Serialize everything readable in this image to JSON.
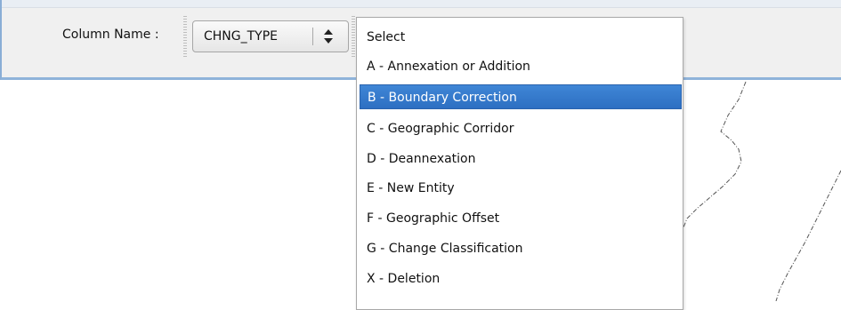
{
  "toolbar": {
    "column_label": "Column Name :",
    "column_select": {
      "value": "CHNG_TYPE"
    }
  },
  "dropdown": {
    "options": [
      "Select",
      "A - Annexation or Addition",
      "B - Boundary Correction",
      "C - Geographic Corridor",
      "D - Deannexation",
      "E - New Entity",
      "F - Geographic Offset",
      "G - Change Classification",
      "X - Deletion"
    ],
    "highlighted": "B - Boundary Correction"
  },
  "colors": {
    "highlight": "#3a7fd2",
    "toolbar_border": "#8fb3da"
  }
}
